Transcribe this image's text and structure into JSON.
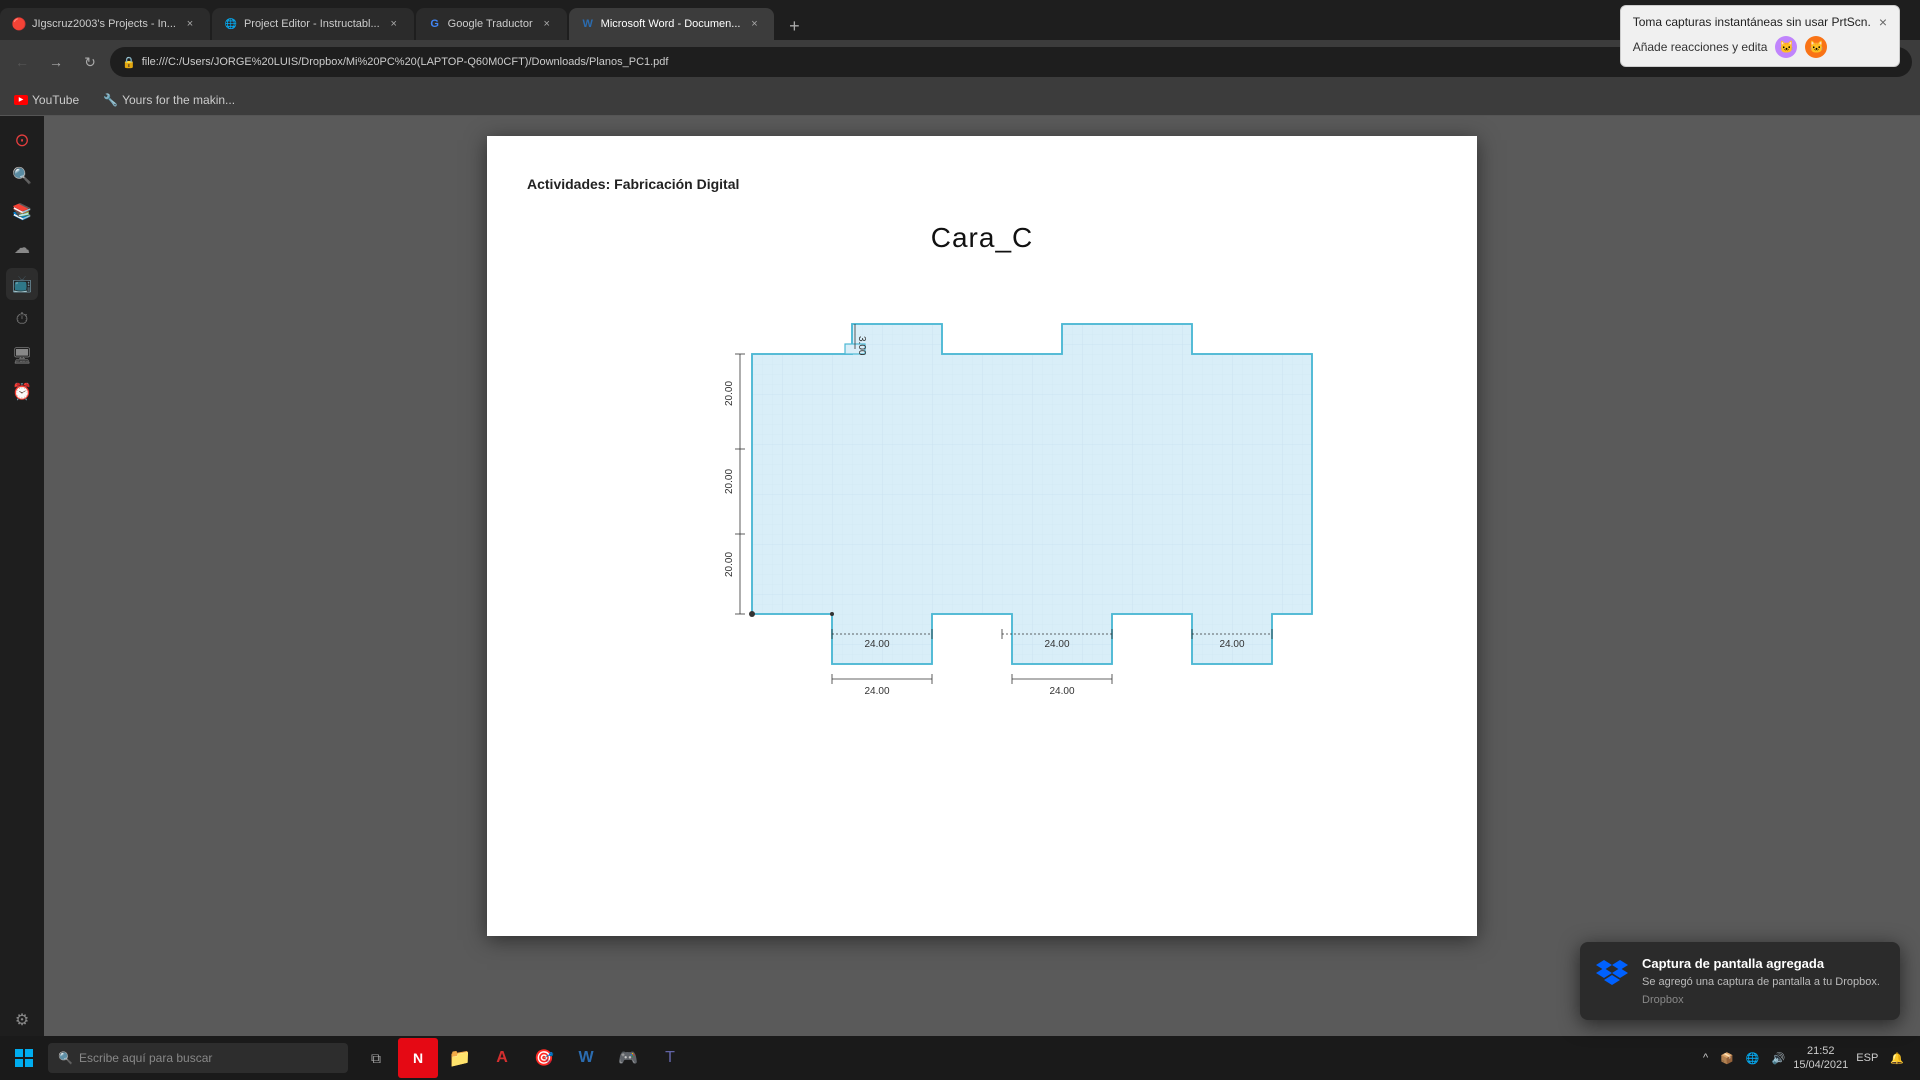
{
  "browser": {
    "tabs": [
      {
        "id": "tab1",
        "title": "JIgscruz2003's Projects - In...",
        "favicon": "🔴",
        "active": false,
        "closable": true
      },
      {
        "id": "tab2",
        "title": "Project Editor - Instructabl...",
        "favicon": "🌐",
        "active": false,
        "closable": true
      },
      {
        "id": "tab3",
        "title": "Google Traductor",
        "favicon": "T",
        "active": false,
        "closable": true
      },
      {
        "id": "tab4",
        "title": "Microsoft Word - Documen...",
        "favicon": "W",
        "active": true,
        "closable": true
      }
    ],
    "address": "file:///C:/Users/JORGE%20LUIS/Dropbox/Mi%20PC%20(LAPTOP-Q60M0CFT)/Downloads/Planos_PC1.pdf",
    "notification": {
      "line1": "Toma capturas instantáneas sin usar PrtScn.",
      "line2": "Añade reacciones y edita"
    }
  },
  "bookmarks": [
    {
      "label": "YouTube",
      "type": "youtube"
    },
    {
      "label": "Yours for the makin...",
      "type": "instructables"
    }
  ],
  "sidebar": {
    "icons": [
      "⊙",
      "🔍",
      "📚",
      "☁",
      "📺",
      "⏱",
      "🖥",
      "⏰",
      "⚙",
      "···"
    ]
  },
  "pdf": {
    "header": "Actividades: Fabricación Digital",
    "title": "Cara_C",
    "dimensions": {
      "top_notch_height": "3.00",
      "left_top": "20.00",
      "left_mid": "20.00",
      "left_bot": "20.00",
      "bottom_notches_top": "24.00",
      "measurements": [
        "24.00",
        "24.00",
        "24.00",
        "24.00",
        "24.00"
      ]
    }
  },
  "taskbar": {
    "search_placeholder": "Escribe aquí para buscar",
    "apps": [
      "⊞",
      "🎤",
      "N",
      "📁",
      "A",
      "🎯",
      "W",
      "🎮",
      "T"
    ],
    "tray": {
      "time": "21:52",
      "date": "15/04/2021",
      "language": "ESP"
    }
  },
  "notification_popup": {
    "title": "Captura de pantalla agregada",
    "body": "Se agregó una captura de pantalla a tu Dropbox.",
    "source": "Dropbox"
  }
}
